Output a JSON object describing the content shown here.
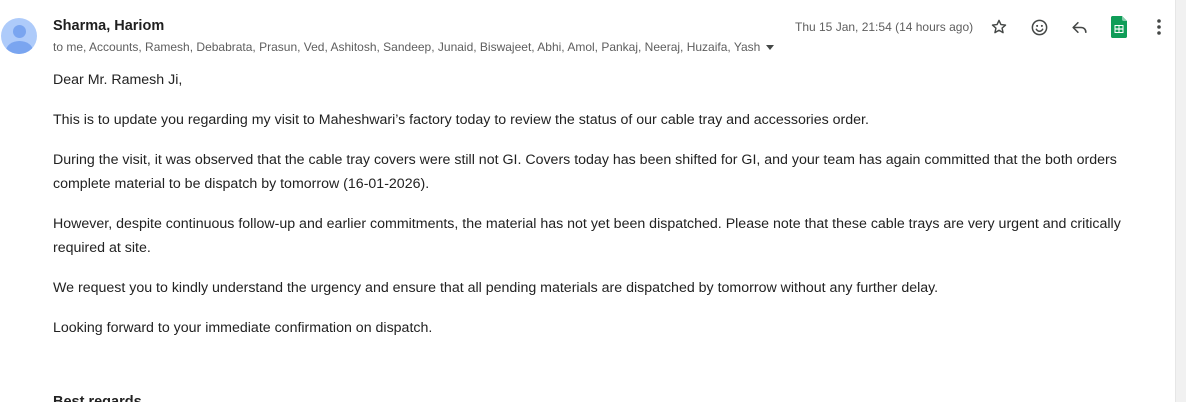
{
  "email": {
    "sender_name": "Sharma, Hariom",
    "recipients": "to me, Accounts, Ramesh, Debabrata, Prasun, Ved, Ashitosh, Sandeep, Junaid, Biswajeet, Abhi, Amol, Pankaj, Neeraj, Huzaifa, Yash",
    "timestamp": "Thu 15 Jan, 21:54 (14 hours ago)",
    "paragraphs": [
      "Dear Mr. Ramesh Ji,",
      "This is to update you regarding my visit to Maheshwari’s factory today to review the status of our cable tray and accessories order.",
      "During the visit, it was observed that the cable tray covers were still not GI. Covers today has been shifted for GI, and your team has again committed that the both orders complete material to be dispatch by tomorrow (16-01-2026).",
      "However, despite continuous follow-up and earlier commitments, the material has not yet been dispatched. Please note that these cable trays are very urgent and critically required at site.",
      "We request you to kindly understand the urgency and ensure that all pending materials are dispatched by tomorrow without any further delay.",
      "Looking forward to your immediate confirmation on dispatch."
    ],
    "signoff_partial": "Best regards,"
  },
  "icons": {
    "star": "star-icon",
    "emoji": "emoji-icon",
    "reply": "reply-icon",
    "sheets": "google-sheets-icon",
    "more": "more-vert-icon"
  },
  "colors": {
    "avatar_bg": "#aecbfa",
    "avatar_fg": "#7aa5f0",
    "sheets_green": "#0f9d58",
    "muted_text": "#5e5e5e"
  }
}
